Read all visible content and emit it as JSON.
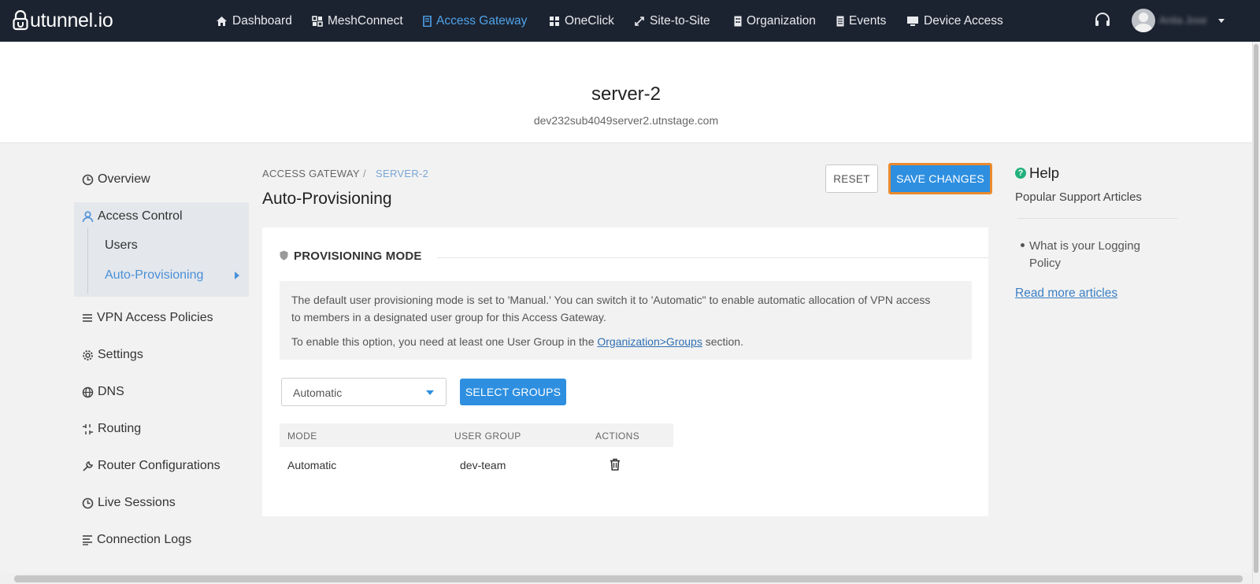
{
  "app": {
    "logo_text": "utunnel.io",
    "user_name": "Anita Jose"
  },
  "nav": {
    "items": [
      {
        "label": "Dashboard",
        "icon": "home-icon"
      },
      {
        "label": "MeshConnect",
        "icon": "mesh-icon"
      },
      {
        "label": "Access Gateway",
        "icon": "server-icon",
        "active": true
      },
      {
        "label": "OneClick",
        "icon": "grid-icon"
      },
      {
        "label": "Site-to-Site",
        "icon": "link-icon"
      },
      {
        "label": "Organization",
        "icon": "building-icon"
      },
      {
        "label": "Events",
        "icon": "list-icon"
      },
      {
        "label": "Device Access",
        "icon": "monitor-icon"
      }
    ]
  },
  "server": {
    "name": "server-2",
    "host": "dev232sub4049server2.utnstage.com"
  },
  "sidebar": {
    "overview": "Overview",
    "access_control": "Access Control",
    "users": "Users",
    "auto_provisioning": "Auto-Provisioning",
    "vpn_policies": "VPN Access Policies",
    "settings": "Settings",
    "dns": "DNS",
    "routing": "Routing",
    "router_configs": "Router Configurations",
    "live_sessions": "Live Sessions",
    "connection_logs": "Connection Logs"
  },
  "breadcrumb": {
    "parent": "ACCESS GATEWAY",
    "separator": "/",
    "current": "SERVER-2"
  },
  "page": {
    "title": "Auto-Provisioning",
    "reset_label": "RESET",
    "save_label": "SAVE CHANGES"
  },
  "provisioning": {
    "heading": "PROVISIONING MODE",
    "info_line1": "The default user provisioning mode is set to 'Manual.' You can switch it to 'Automatic\" to enable automatic allocation of VPN access",
    "info_line2": "to members in a designated user group for this Access Gateway.",
    "info_line3_pre": "To enable this option, you need at least one User Group in the ",
    "info_line3_link": "Organization>Groups",
    "info_line3_post": " section.",
    "mode_selected": "Automatic",
    "select_groups_label": "SELECT GROUPS",
    "table": {
      "columns": [
        "MODE",
        "USER GROUP",
        "ACTIONS"
      ],
      "rows": [
        {
          "mode": "Automatic",
          "user_group": "dev-team"
        }
      ]
    }
  },
  "help": {
    "title": "Help",
    "subtitle": "Popular Support Articles",
    "articles": [
      "What is your Logging Policy"
    ],
    "more_link": "Read more articles"
  },
  "colors": {
    "nav_bg": "#1c2330",
    "accent": "#2e8fe0",
    "highlight": "#ea8a2e",
    "help_icon": "#22b07d"
  }
}
